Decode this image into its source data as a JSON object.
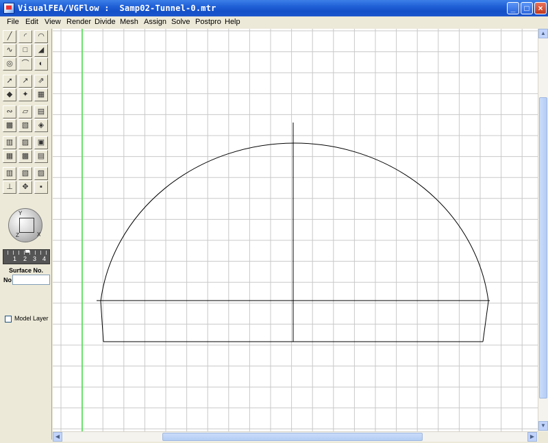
{
  "window": {
    "title": "VisualFEA/VGFlow :  Samp02-Tunnel-0.mtr",
    "controls": {
      "minimize": "_",
      "maximize": "□",
      "close": "×"
    }
  },
  "menu": {
    "items": [
      "File",
      "Edit",
      "View",
      "Render",
      "Divide",
      "Mesh",
      "Assign",
      "Solve",
      "Postpro",
      "Help"
    ]
  },
  "toolbar": {
    "buttons": [
      "line-tool-icon",
      "arc-tool-icon",
      "curve-tool-icon",
      "spline-tool-icon",
      "rectangle-tool-icon",
      "surface-tool-icon",
      "circle-tool-icon",
      "arch-tool-icon",
      "ellipse-tool-icon",
      "select-arrow-icon",
      "select-curve-icon",
      "select-surface-icon",
      "pick-node-icon",
      "pick-region-icon",
      "pick-box-icon",
      "sweep-icon",
      "extrude-icon",
      "loft-icon",
      "solid-box-icon",
      "solid-cut-icon",
      "solid-rotate-icon",
      "solid-stack-icon",
      "solid-split-icon",
      "solid-merge-icon",
      "mesh-plane-icon",
      "mesh-cube-icon",
      "mesh-sheet-icon",
      "mesh-grid-icon",
      "mesh-block-icon",
      "mesh-dense-icon",
      "axis-icon",
      "move-icon",
      "center-icon"
    ],
    "view_dial": {
      "axis_y": "Y",
      "axis_x": "X",
      "axis_z": "Z"
    },
    "layer_slider": {
      "labels": [
        "1",
        "2",
        "3",
        "4"
      ]
    },
    "surface_no_label": "Surface No.",
    "no_label": "No",
    "no_value": "",
    "model_layer_label": "Model Layer",
    "model_layer_checked": false
  },
  "canvas": {
    "background": "#ffffff",
    "grid_color": "#c8c8c8",
    "axis_line_color": "#44dd44",
    "shape_color": "#000000"
  },
  "scrollbars": {
    "up": "▲",
    "down": "▼",
    "left": "◀",
    "right": "▶"
  }
}
